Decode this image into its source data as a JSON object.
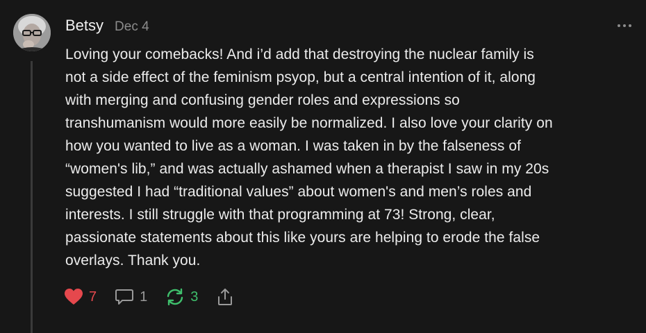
{
  "comment": {
    "author": "Betsy",
    "date": "Dec 4",
    "body_lines": [
      "Loving your comebacks! And i’d add that destroying the nuclear family is",
      "not a side effect of the feminism psyop, but a central intention of it, along",
      "with merging and confusing gender roles and expressions so",
      "transhumanism would more easily be normalized. I also love your clarity on",
      "how you wanted to live as a woman. I was taken in by the falseness of",
      "“women's lib,” and was actually ashamed when a therapist I saw in my 20s",
      "suggested I had “traditional values” about women's and men’s roles and",
      "interests. I still struggle with that programming at 73! Strong, clear,",
      "passionate statements about this like yours are helping to erode the false",
      "overlays. Thank you."
    ]
  },
  "actions": {
    "like_count": "7",
    "reply_count": "1",
    "restack_count": "3"
  },
  "icons": {
    "like": "heart-icon",
    "reply": "speech-bubble-icon",
    "restack": "restack-arrows-icon",
    "share": "share-icon",
    "more": "more-dots-icon"
  },
  "colors": {
    "background": "#171717",
    "like": "#e5484d",
    "restack": "#3fbf6c",
    "muted": "#8c8c8c"
  }
}
